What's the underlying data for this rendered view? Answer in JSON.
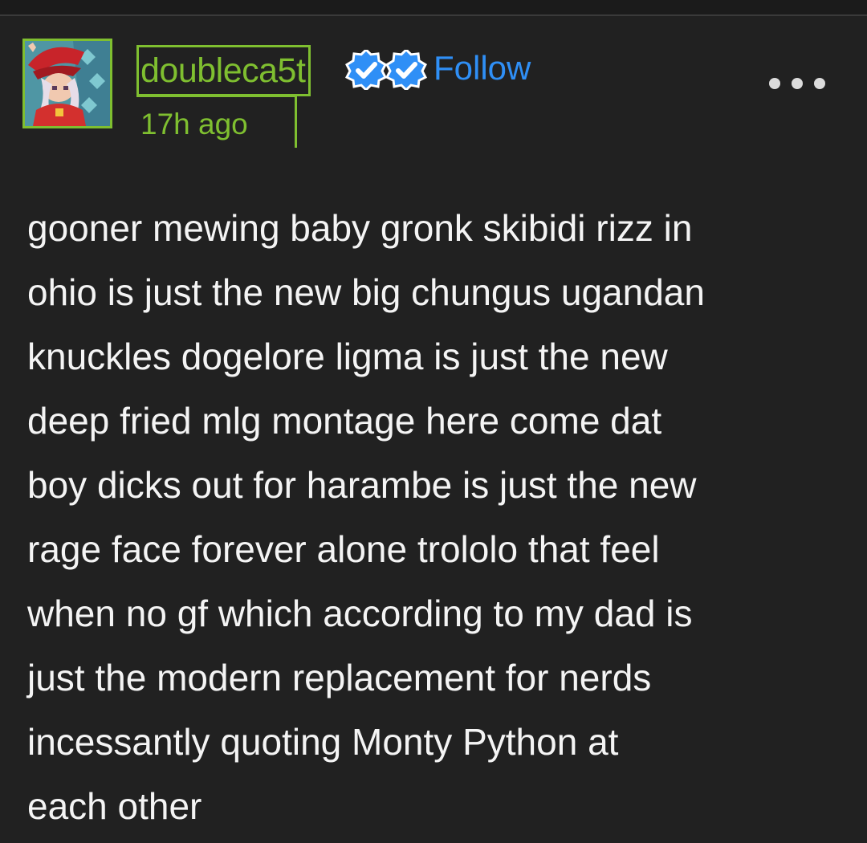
{
  "post": {
    "username": "doubleca5t",
    "timestamp": "17h ago",
    "follow_label": "Follow",
    "body": "gooner mewing baby gronk skibidi rizz in\nohio is just the new big chungus ugandan\nknuckles dogelore ligma is just the new\ndeep fried mlg montage here come dat\nboy dicks out for harambe is just the new\nrage face forever alone trololo that feel\nwhen no gf which according to my dad is\njust the modern replacement for nerds\nincessantly quoting Monty Python at\neach other"
  },
  "icons": {
    "badges": [
      "verified-badge-icon",
      "verified-badge-icon"
    ],
    "more": "more-options-icon"
  },
  "colors": {
    "background": "#212121",
    "accent_green": "#7fbf30",
    "follow_blue": "#2f8ff6",
    "text": "#f4f4f4"
  }
}
